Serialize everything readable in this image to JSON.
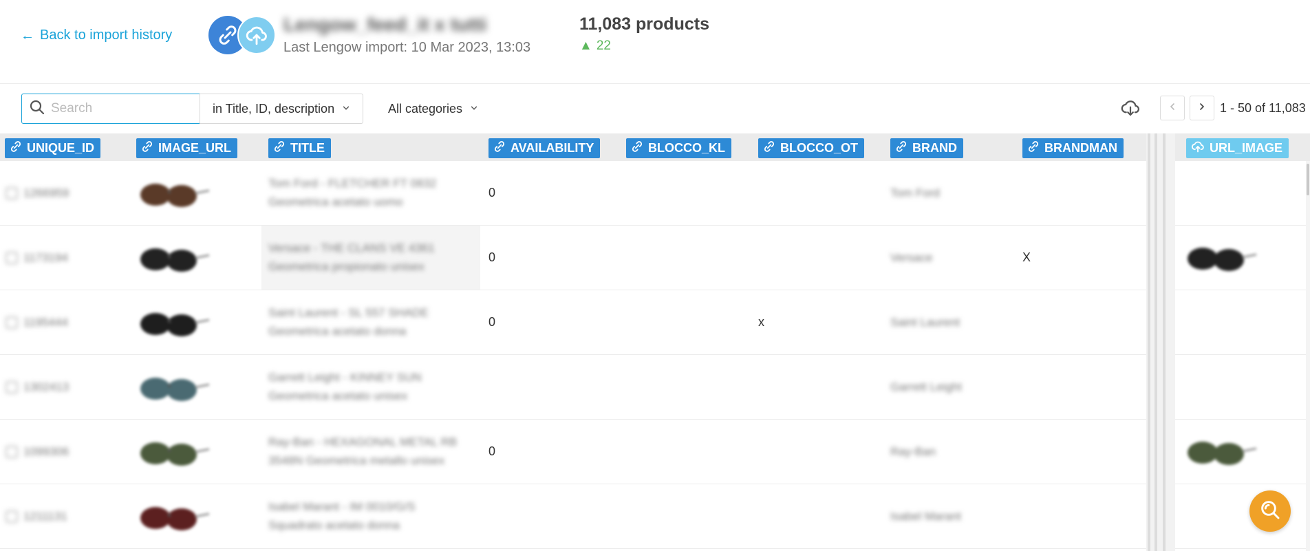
{
  "header": {
    "back_label": "Back to import history",
    "feed_name": "Lengow_feed_it x tutti",
    "last_import": "Last Lengow import: 10 Mar 2023, 13:03",
    "product_count": "11,083 products",
    "delta": "22",
    "delta_symbol": "▲"
  },
  "toolbar": {
    "search_placeholder": "Search",
    "search_scope": "in Title, ID, description",
    "category": "All categories",
    "pagination": "1 - 50 of 11,083"
  },
  "columns": [
    {
      "label": "UNIQUE_ID",
      "icon": "link-icon"
    },
    {
      "label": "IMAGE_URL",
      "icon": "link-icon"
    },
    {
      "label": "TITLE",
      "icon": "link-icon"
    },
    {
      "label": "AVAILABILITY",
      "icon": "link-icon"
    },
    {
      "label": "BLOCCO_KL",
      "icon": "link-icon"
    },
    {
      "label": "BLOCCO_OT",
      "icon": "link-icon"
    },
    {
      "label": "BRAND",
      "icon": "link-icon"
    },
    {
      "label": "BRANDMAN",
      "icon": "link-icon"
    },
    {
      "label": "URL_IMAGE",
      "icon": "cloud-upload-icon"
    }
  ],
  "rows": [
    {
      "id": "1266959",
      "title1": "Tom Ford - FLETCHER FT 0832",
      "title2": "Geometrica acetato uomo",
      "availability": "0",
      "blocco_kl": "",
      "blocco_ot": "",
      "brand": "Tom Ford",
      "brandman": "",
      "image_color": "#5a3a28"
    },
    {
      "id": "1173194",
      "title1": "Versace - THE CLANS VE 4361",
      "title2": "Geometrica propionato unisex",
      "availability": "0",
      "blocco_kl": "",
      "blocco_ot": "",
      "brand": "Versace",
      "brandman": "X",
      "image_color": "#222222"
    },
    {
      "id": "1195444",
      "title1": "Saint Laurent - SL 557 SHADE",
      "title2": "Geometrica acetato donna",
      "availability": "0",
      "blocco_kl": "",
      "blocco_ot": "x",
      "brand": "Saint Laurent",
      "brandman": "",
      "image_color": "#1e1e1e"
    },
    {
      "id": "1302413",
      "title1": "Garrett Leight - KINNEY SUN",
      "title2": "Geometrica acetato unisex",
      "availability": "",
      "blocco_kl": "",
      "blocco_ot": "",
      "brand": "Garrett Leight",
      "brandman": "",
      "image_color": "#4a6a72"
    },
    {
      "id": "1099306",
      "title1": "Ray-Ban - HEXAGONAL METAL RB",
      "title2": "3548N Geometrica metallo unisex",
      "availability": "0",
      "blocco_kl": "",
      "blocco_ot": "",
      "brand": "Ray-Ban",
      "brandman": "",
      "image_color": "#4b5a3c"
    },
    {
      "id": "1211131",
      "title1": "Isabel Marant - IM 0010/G/S",
      "title2": "Squadrato acetato donna",
      "availability": "",
      "blocco_kl": "",
      "blocco_ot": "",
      "brand": "Isabel Marant",
      "brandman": "",
      "image_color": "#5c2020"
    }
  ],
  "colors": {
    "accent": "#1aa3d9",
    "column_header": "#2d8ad6",
    "column_header_light": "#6fcbef",
    "help_button": "#f0a127",
    "positive": "#5cb85c"
  }
}
